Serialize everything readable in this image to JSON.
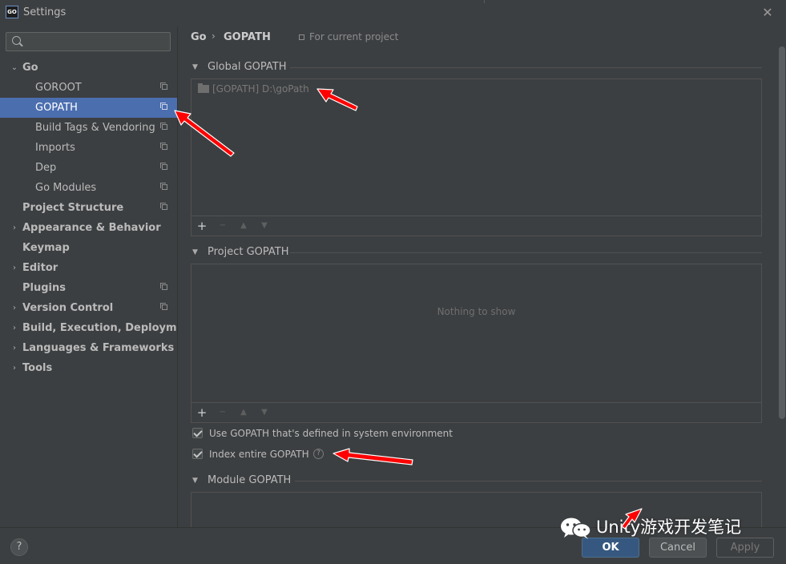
{
  "window": {
    "title": "Settings",
    "logo": "GO"
  },
  "search": {
    "placeholder": "",
    "value": ""
  },
  "sidebar": {
    "items": [
      {
        "label": "Go",
        "expanded": true
      },
      {
        "label": "GOROOT"
      },
      {
        "label": "GOPATH",
        "selected": true
      },
      {
        "label": "Build Tags & Vendoring"
      },
      {
        "label": "Imports"
      },
      {
        "label": "Dep"
      },
      {
        "label": "Go Modules"
      },
      {
        "label": "Project Structure"
      },
      {
        "label": "Appearance & Behavior"
      },
      {
        "label": "Keymap"
      },
      {
        "label": "Editor"
      },
      {
        "label": "Plugins"
      },
      {
        "label": "Version Control"
      },
      {
        "label": "Build, Execution, Deployment"
      },
      {
        "label": "Languages & Frameworks"
      },
      {
        "label": "Tools"
      }
    ]
  },
  "breadcrumb": {
    "parent": "Go",
    "separator": "›",
    "current": "GOPATH",
    "scope": "For current project"
  },
  "sections": {
    "global": {
      "title": "Global GOPATH",
      "entries": [
        {
          "text": "[GOPATH] D:\\goPath"
        }
      ]
    },
    "project": {
      "title": "Project GOPATH",
      "empty_text": "Nothing to show"
    },
    "module": {
      "title": "Module GOPATH"
    }
  },
  "toolbar": {
    "add": "+",
    "remove": "−",
    "up": "▲",
    "down": "▼"
  },
  "options": {
    "use_system_gopath": {
      "label": "Use GOPATH that's defined in system environment",
      "checked": true
    },
    "index_entire_gopath": {
      "label": "Index entire GOPATH",
      "checked": true
    }
  },
  "buttons": {
    "help": "?",
    "ok": "OK",
    "cancel": "Cancel",
    "apply": "Apply"
  },
  "watermark": {
    "text": "Unity游戏开发笔记"
  },
  "colors": {
    "selection": "#4b6eaf",
    "ok_button": "#365880",
    "annotation_arrow": "#ff0000",
    "background": "#3c3f41"
  }
}
